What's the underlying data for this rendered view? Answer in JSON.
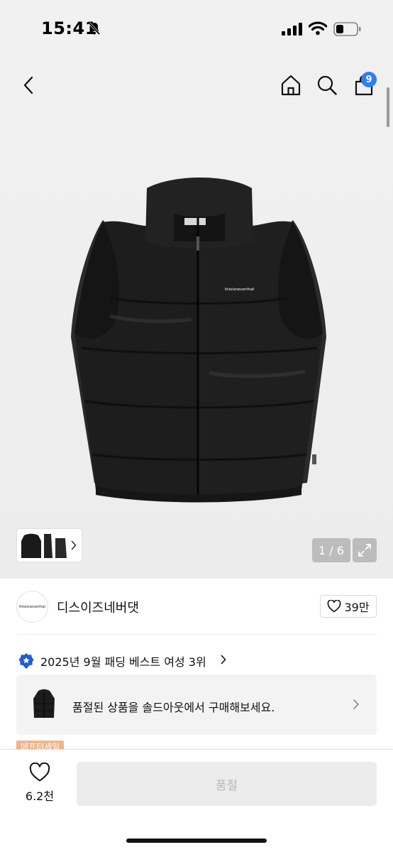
{
  "status_bar": {
    "time": "15:41"
  },
  "header": {
    "cart_count": "9"
  },
  "gallery": {
    "counter": "1 / 6",
    "product_logo_text": "thisisneverthat"
  },
  "brand": {
    "logo_text": "thisisneverthat",
    "name": "디스이즈네버댓",
    "likes": "39만"
  },
  "ranking": {
    "text": "2025년 9월 패딩 베스트 여성 3위"
  },
  "soldout_notice": {
    "text": "품절된 상품을 솔드아웃에서 구매해보세요."
  },
  "tag": {
    "label": "애프터세일"
  },
  "bottom": {
    "wish_count": "6.2천",
    "button_label": "품절"
  },
  "colors": {
    "accent": "#2f7cf6",
    "tag": "#f3b48b",
    "disabled_bg": "#ececec"
  }
}
